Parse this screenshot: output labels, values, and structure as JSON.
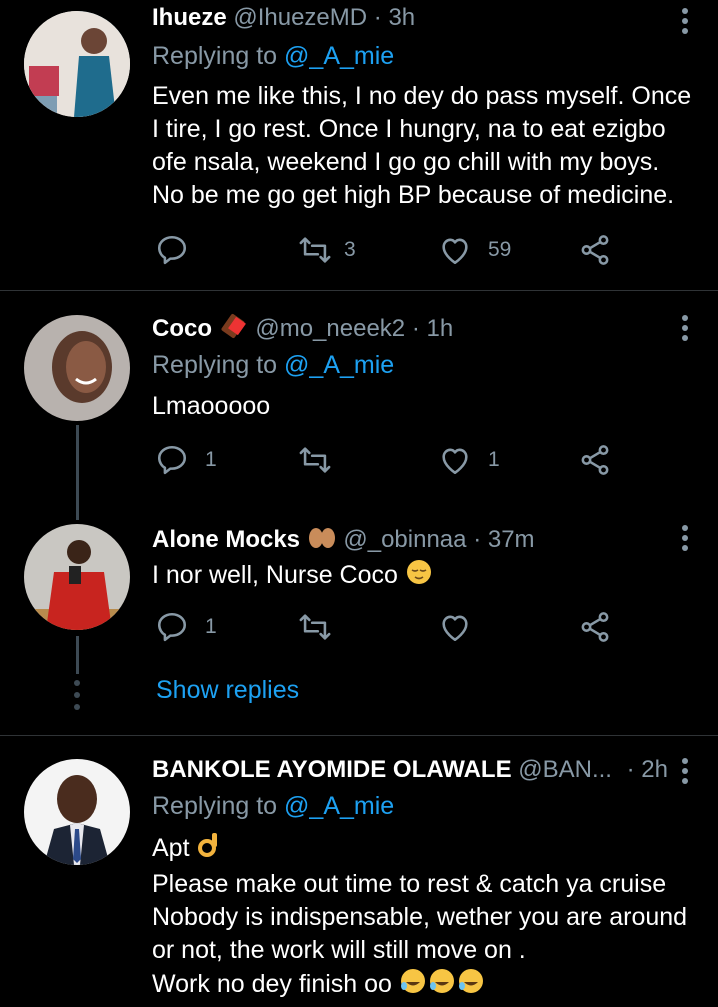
{
  "tweets": [
    {
      "name": "Ihueze",
      "handle": "@IhuezeMD",
      "time": "· 3h",
      "replying_label": "Replying to",
      "replying_to": "@_A_mie",
      "text": "Even me like this, I no dey do pass myself. Once I tire, I go rest. Once I hungry, na to eat ezigbo ofe nsala, weekend I go go chill with my boys. No be me go get high BP because of medicine.",
      "reply_count": "",
      "retweet_count": "3",
      "like_count": "59"
    },
    {
      "name": "Coco",
      "handle": "@mo_neeek2",
      "time": "· 1h",
      "replying_label": "Replying to",
      "replying_to": "@_A_mie",
      "text": "Lmaooooo",
      "reply_count": "1",
      "retweet_count": "",
      "like_count": "1"
    },
    {
      "name": "Alone Mocks",
      "handle": "@_obinnaa",
      "time": "· 37m",
      "text": "I nor well, Nurse Coco",
      "reply_count": "1",
      "retweet_count": "",
      "like_count": ""
    },
    {
      "name": "BANKOLE AYOMIDE OLAWALE",
      "handle": "@BAN...",
      "time": "· 2h",
      "replying_label": "Replying to",
      "replying_to": "@_A_mie",
      "text_lines": [
        "Apt",
        "Please make out time to rest & catch ya cruise",
        "Nobody is indispensable, wether you are around",
        "or not, the work will still move on .",
        "Work no dey finish oo"
      ]
    }
  ],
  "show_replies": "Show replies",
  "icons": [
    "reply-icon",
    "retweet-icon",
    "like-icon",
    "share-icon",
    "more-icon"
  ],
  "colors": {
    "background": "#000000",
    "muted": "#8899a6",
    "link": "#1da1f2",
    "divider": "#2f3336"
  }
}
